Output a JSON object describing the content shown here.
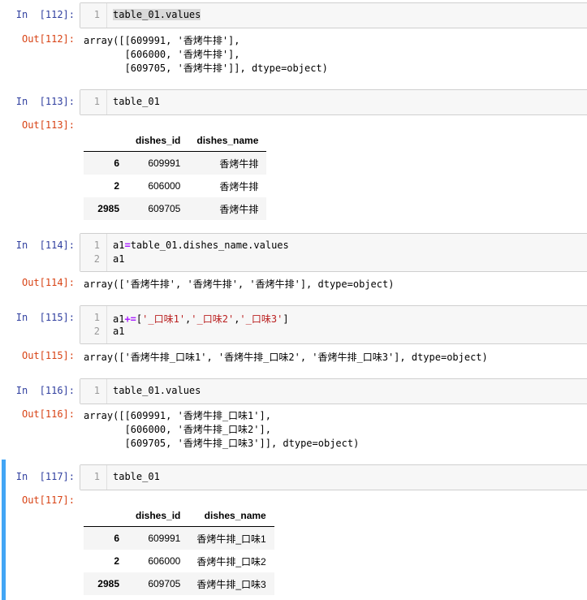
{
  "cells": [
    {
      "in_prompt": "In  [112]:",
      "code": [
        "table_01.values"
      ],
      "out_prompt": "Out[112]:",
      "output_lines": [
        "array([[609991, '香烤牛排'],",
        "       [606000, '香烤牛排'],",
        "       [609705, '香烤牛排']], dtype=object)"
      ]
    },
    {
      "in_prompt": "In  [113]:",
      "code": [
        "table_01"
      ],
      "out_prompt": "Out[113]:",
      "table": {
        "columns": [
          "dishes_id",
          "dishes_name"
        ],
        "rows": [
          {
            "index": "6",
            "cells": [
              "609991",
              "香烤牛排"
            ]
          },
          {
            "index": "2",
            "cells": [
              "606000",
              "香烤牛排"
            ]
          },
          {
            "index": "2985",
            "cells": [
              "609705",
              "香烤牛排"
            ]
          }
        ]
      }
    },
    {
      "in_prompt": "In  [114]:",
      "code": [
        "a1=table_01.dishes_name.values",
        "a1"
      ],
      "out_prompt": "Out[114]:",
      "output_lines": [
        "array(['香烤牛排', '香烤牛排', '香烤牛排'], dtype=object)"
      ]
    },
    {
      "in_prompt": "In  [115]:",
      "code": [
        "a1+=['_口味1','_口味2','_口味3']",
        "a1"
      ],
      "out_prompt": "Out[115]:",
      "output_lines": [
        "array(['香烤牛排_口味1', '香烤牛排_口味2', '香烤牛排_口味3'], dtype=object)"
      ]
    },
    {
      "in_prompt": "In  [116]:",
      "code": [
        "table_01.values"
      ],
      "out_prompt": "Out[116]:",
      "output_lines": [
        "array([[609991, '香烤牛排_口味1'],",
        "       [606000, '香烤牛排_口味2'],",
        "       [609705, '香烤牛排_口味3']], dtype=object)"
      ]
    },
    {
      "in_prompt": "In  [117]:",
      "code": [
        "table_01"
      ],
      "out_prompt": "Out[117]:",
      "table": {
        "columns": [
          "dishes_id",
          "dishes_name"
        ],
        "rows": [
          {
            "index": "6",
            "cells": [
              "609991",
              "香烤牛排_口味1"
            ]
          },
          {
            "index": "2",
            "cells": [
              "606000",
              "香烤牛排_口味2"
            ]
          },
          {
            "index": "2985",
            "cells": [
              "609705",
              "香烤牛排_口味3"
            ]
          }
        ]
      }
    }
  ],
  "line_numbers": [
    "1",
    "2"
  ],
  "colors": {
    "in_prompt": "#303f9f",
    "out_prompt": "#d84315",
    "active_cell": "#42a5f5",
    "keyword": "#aa22ff",
    "string": "#ba2121"
  }
}
